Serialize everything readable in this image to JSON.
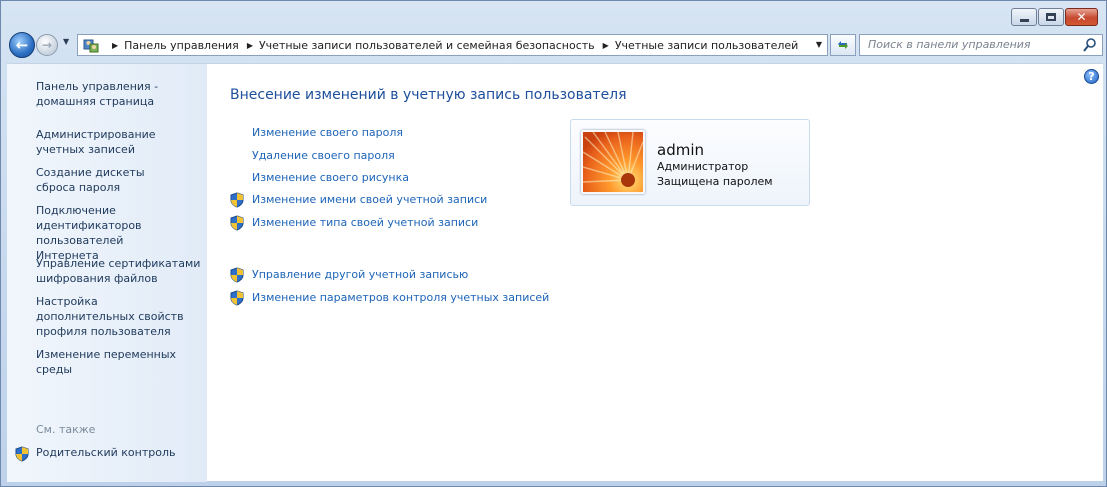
{
  "window": {
    "caption_buttons": {
      "minimize": "minimize",
      "maximize": "maximize",
      "close": "✕"
    }
  },
  "nav": {
    "back_icon": "arrow-left-icon",
    "forward_icon": "arrow-right-icon",
    "breadcrumbs": [
      "Панель управления",
      "Учетные записи пользователей и семейная безопасность",
      "Учетные записи пользователей"
    ],
    "search_placeholder": "Поиск в панели управления"
  },
  "sidebar": {
    "items": [
      "Панель управления - домашняя страница",
      "Администрирование учетных записей",
      "Создание дискеты сброса пароля",
      "Подключение идентификаторов пользователей Интернета",
      "Управление сертификатами шифрования файлов",
      "Настройка дополнительных свойств профиля пользователя",
      "Изменение переменных среды"
    ],
    "see_also": "См. также",
    "parental_control": "Родительский контроль"
  },
  "main": {
    "title": "Внесение изменений в учетную запись пользователя",
    "tasks": [
      {
        "label": "Изменение своего пароля",
        "shield": false
      },
      {
        "label": "Удаление своего пароля",
        "shield": false
      },
      {
        "label": "Изменение своего рисунка",
        "shield": false
      },
      {
        "label": "Изменение имени своей учетной записи",
        "shield": true
      },
      {
        "label": "Изменение типа своей учетной записи",
        "shield": true
      }
    ],
    "other_tasks": [
      {
        "label": "Управление другой учетной записью",
        "shield": true
      },
      {
        "label": "Изменение параметров контроля учетных записей",
        "shield": true
      }
    ],
    "account": {
      "name": "admin",
      "role": "Администратор",
      "status": "Защищена паролем"
    }
  },
  "colors": {
    "link": "#1d64b8",
    "title": "#1e4f9c",
    "sidebar_link": "#1e395b",
    "close_button": "#c74a32"
  }
}
